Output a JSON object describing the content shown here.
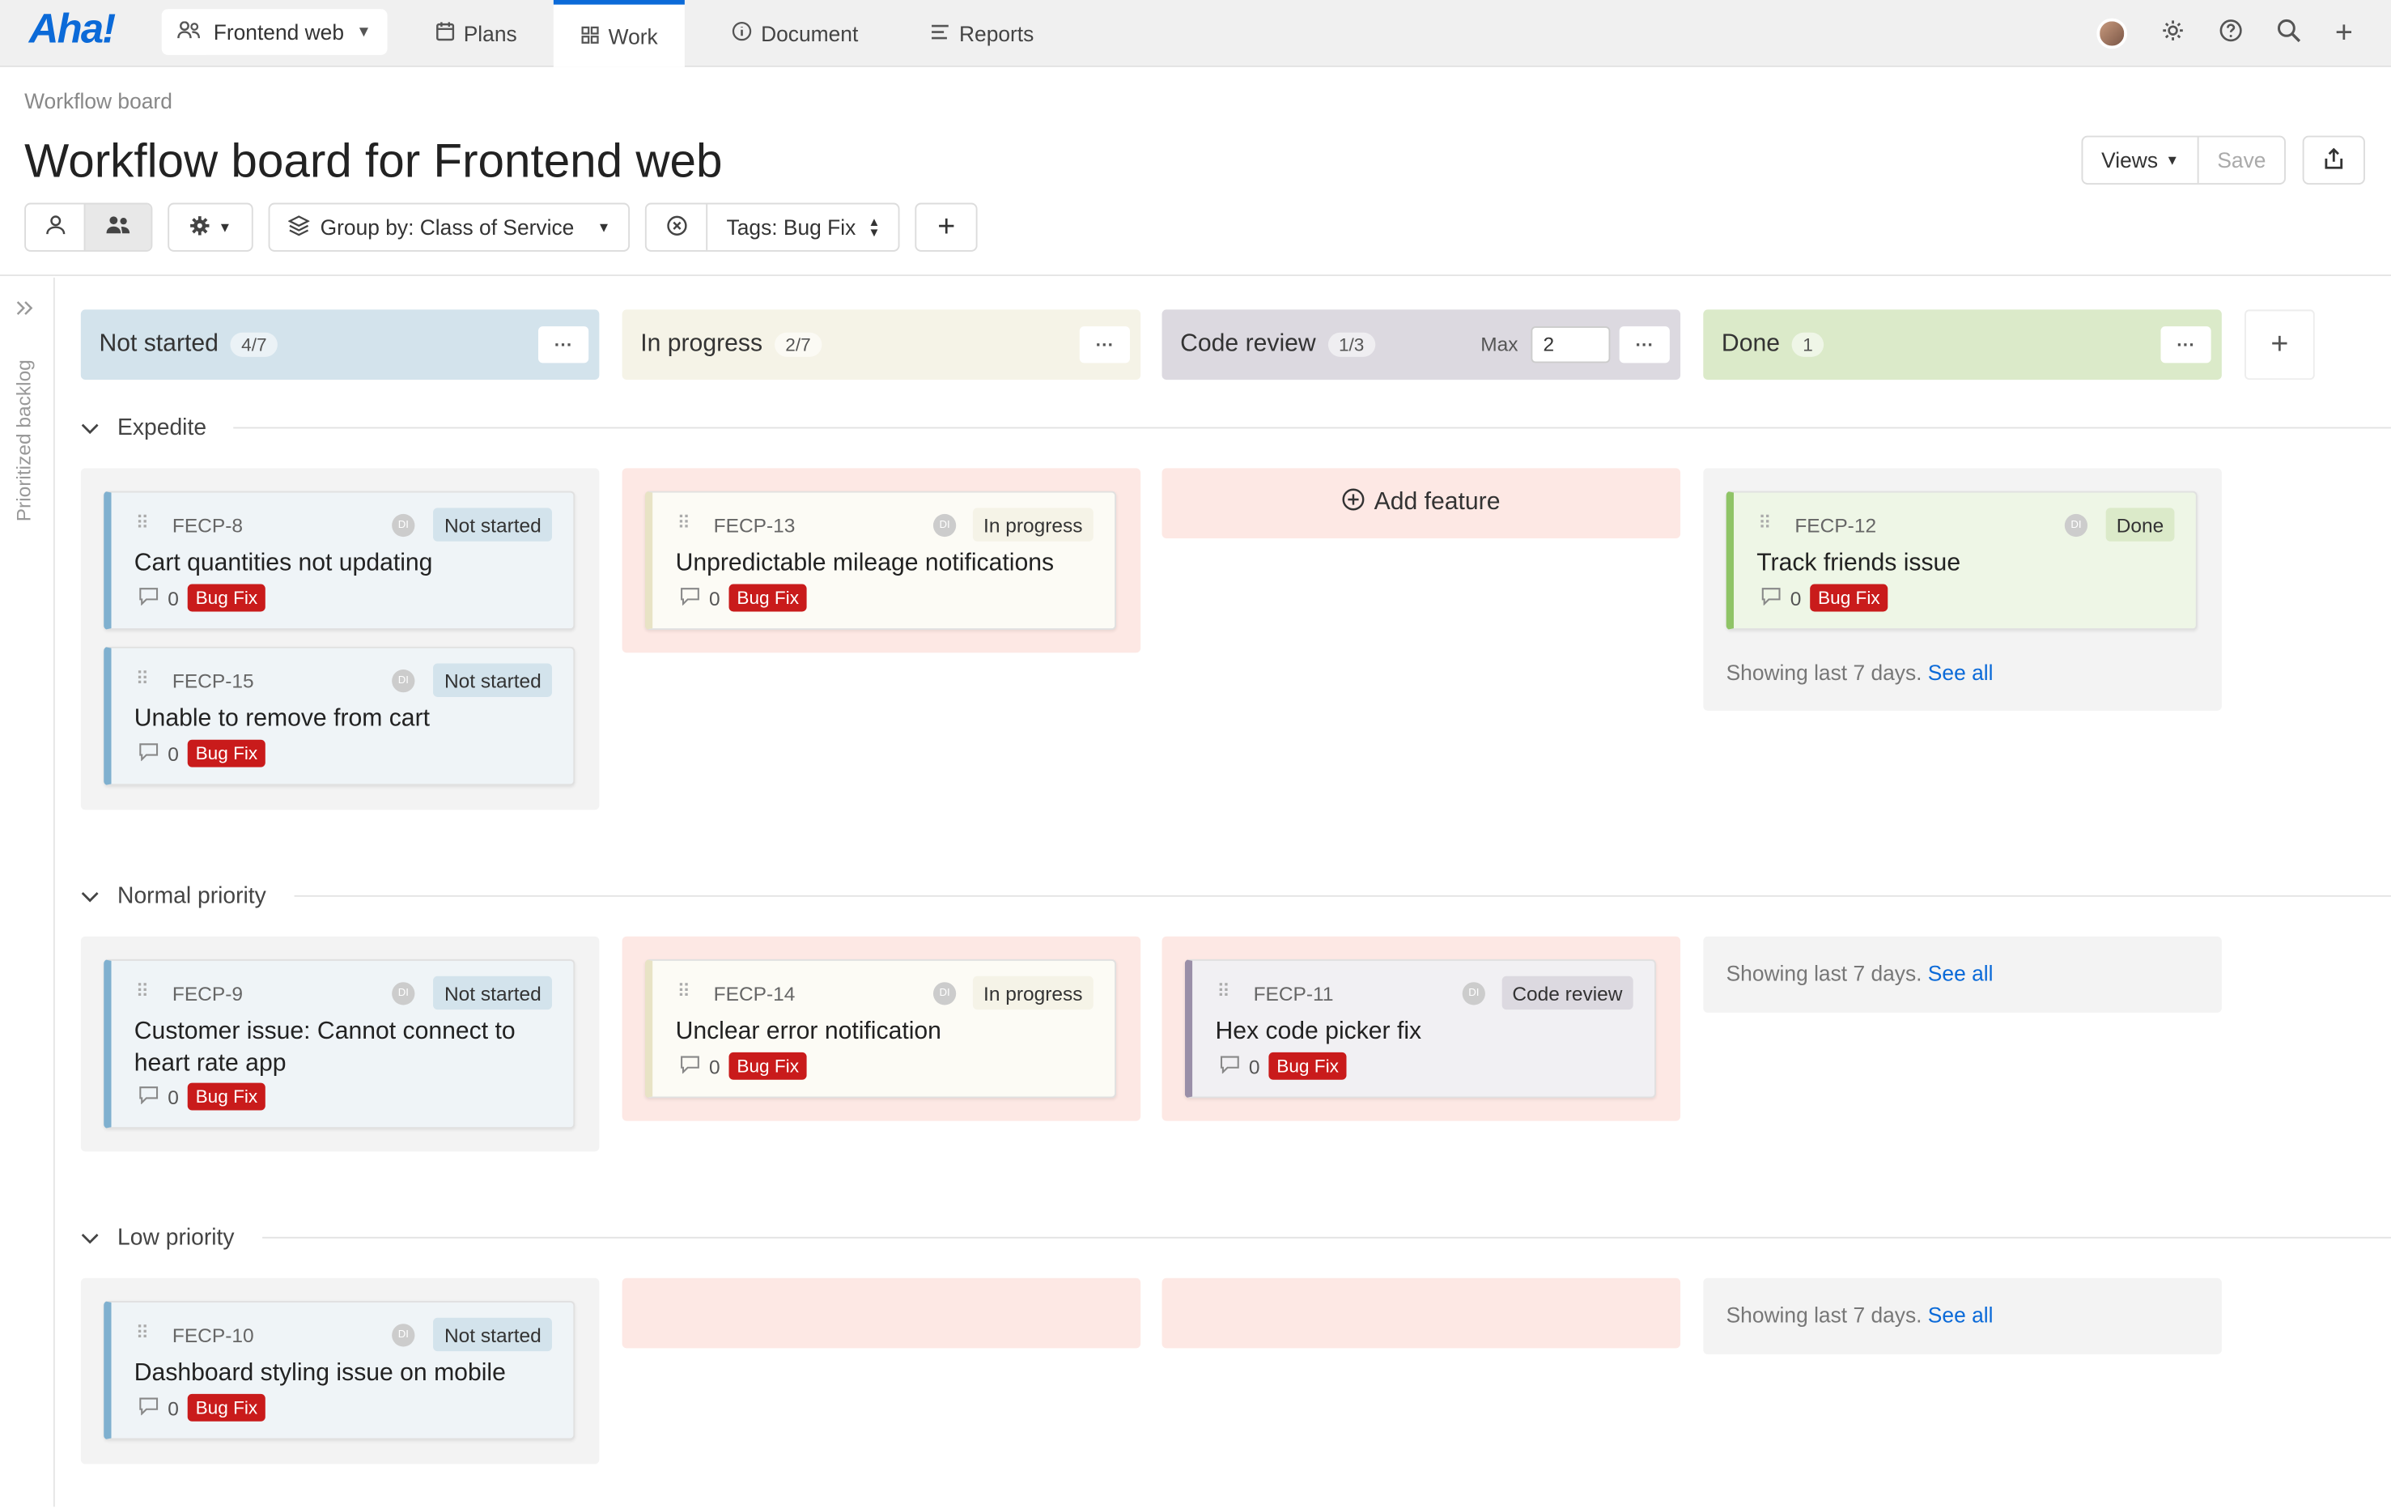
{
  "nav": {
    "logo": "Aha!",
    "workspace": "Frontend web",
    "tabs": [
      {
        "label": "Plans"
      },
      {
        "label": "Work"
      },
      {
        "label": "Document"
      },
      {
        "label": "Reports"
      }
    ],
    "active_tab": "Work"
  },
  "header": {
    "breadcrumb": "Workflow board",
    "title": "Workflow board for Frontend web",
    "views_label": "Views",
    "save_label": "Save"
  },
  "toolbar": {
    "group_by": "Group by: Class of Service",
    "tags_filter": "Tags: Bug Fix"
  },
  "sidebar": {
    "label": "Prioritized backlog"
  },
  "columns": [
    {
      "name": "Not started",
      "count": "4/7",
      "color": "#d3e3ec"
    },
    {
      "name": "In progress",
      "count": "2/7",
      "color": "#f5f3e7"
    },
    {
      "name": "Code review",
      "count": "1/3",
      "color": "#dcd9e0",
      "max_label": "Max",
      "max_value": "2"
    },
    {
      "name": "Done",
      "count": "1",
      "color": "#dbeac9"
    }
  ],
  "swimlanes": [
    {
      "name": "Expedite"
    },
    {
      "name": "Normal priority"
    },
    {
      "name": "Low priority"
    }
  ],
  "cards": [
    {
      "id": "FECP-8",
      "avatar": "DI",
      "status": "Not started",
      "title": "Cart quantities not updating",
      "comments": "0",
      "tag": "Bug Fix"
    },
    {
      "id": "FECP-15",
      "avatar": "DI",
      "status": "Not started",
      "title": "Unable to remove from cart",
      "comments": "0",
      "tag": "Bug Fix"
    },
    {
      "id": "FECP-13",
      "avatar": "DI",
      "status": "In progress",
      "title": "Unpredictable mileage notifications",
      "comments": "0",
      "tag": "Bug Fix"
    },
    {
      "id": "FECP-12",
      "avatar": "DI",
      "status": "Done",
      "title": "Track friends issue",
      "comments": "0",
      "tag": "Bug Fix"
    },
    {
      "id": "FECP-9",
      "avatar": "DI",
      "status": "Not started",
      "title": "Customer issue: Cannot connect to heart rate app",
      "comments": "0",
      "tag": "Bug Fix"
    },
    {
      "id": "FECP-14",
      "avatar": "DI",
      "status": "In progress",
      "title": "Unclear error notification",
      "comments": "0",
      "tag": "Bug Fix"
    },
    {
      "id": "FECP-11",
      "avatar": "DI",
      "status": "Code review",
      "title": "Hex code picker fix",
      "comments": "0",
      "tag": "Bug Fix"
    },
    {
      "id": "FECP-10",
      "avatar": "DI",
      "status": "Not started",
      "title": "Dashboard styling issue on mobile",
      "comments": "0",
      "tag": "Bug Fix"
    }
  ],
  "add_feature_label": "Add feature",
  "done_cells": {
    "showing_text": "Showing last 7 days.",
    "see_all": "See all"
  }
}
